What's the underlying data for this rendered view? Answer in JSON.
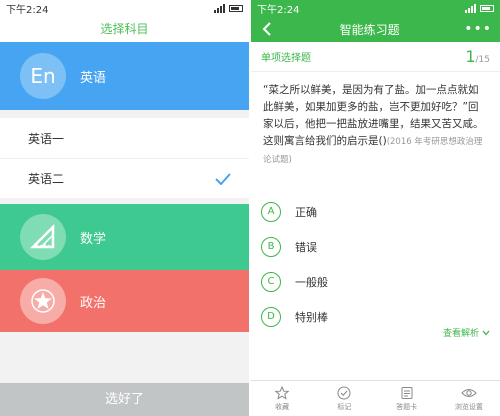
{
  "left": {
    "status": {
      "time": "下午2:24"
    },
    "title": "选择科目",
    "subjects": [
      {
        "badge": "En",
        "label": "英语",
        "color": "#47a4f2"
      },
      {
        "badge": "triangle-ruler-icon",
        "label": "数学",
        "color": "#3dc98f"
      },
      {
        "badge": "star-icon",
        "label": "政治",
        "color": "#f2716a"
      }
    ],
    "english_items": [
      {
        "label": "英语一",
        "selected": false
      },
      {
        "label": "英语二",
        "selected": true
      }
    ],
    "confirm_label": "选好了"
  },
  "right": {
    "status": {
      "time": "下午2:24"
    },
    "nav": {
      "title": "智能练习题"
    },
    "question_type": "单项选择题",
    "progress": {
      "current": "1",
      "total": "/15"
    },
    "question": {
      "text": "“菜之所以鲜美，是因为有了盐。加一点点就如此鲜美，如果加更多的盐，岂不更加好吃？”回家以后，他把一把盐放进嘴里，结果又苦又咸。这则寓言给我们的启示是()",
      "source": "(2016 年考研思想政治理论试题)"
    },
    "options": [
      {
        "letter": "A",
        "text": "正确"
      },
      {
        "letter": "B",
        "text": "错误"
      },
      {
        "letter": "C",
        "text": "一般般"
      },
      {
        "letter": "D",
        "text": "特别棒"
      }
    ],
    "analysis_label": "查看解析",
    "tabs": [
      {
        "icon": "star-icon",
        "label": "收藏"
      },
      {
        "icon": "check-circle-icon",
        "label": "标记"
      },
      {
        "icon": "answer-card-icon",
        "label": "答题卡"
      },
      {
        "icon": "eye-icon",
        "label": "浏览设置"
      }
    ],
    "accent": "#3cb74b"
  }
}
